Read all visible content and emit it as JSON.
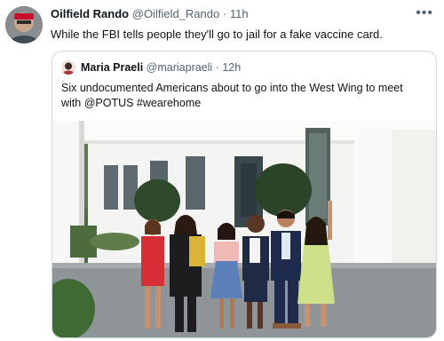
{
  "tweet": {
    "display_name": "Oilfield Rando",
    "handle": "@Oilfield_Rando",
    "separator": "·",
    "time": "11h",
    "text": "While the FBI tells people they'll go to jail for a fake vaccine card.",
    "more_icon": "more-horizontal-icon"
  },
  "quoted": {
    "display_name": "Maria Praeli",
    "handle": "@mariapraeli",
    "separator": "·",
    "time": "12h",
    "text_line1": "Six undocumented Americans about to go into the West Wing to meet",
    "text_line2": "with @POTUS #wearehome"
  },
  "colors": {
    "secondary_text": "#536471",
    "border": "#cfd9de"
  }
}
